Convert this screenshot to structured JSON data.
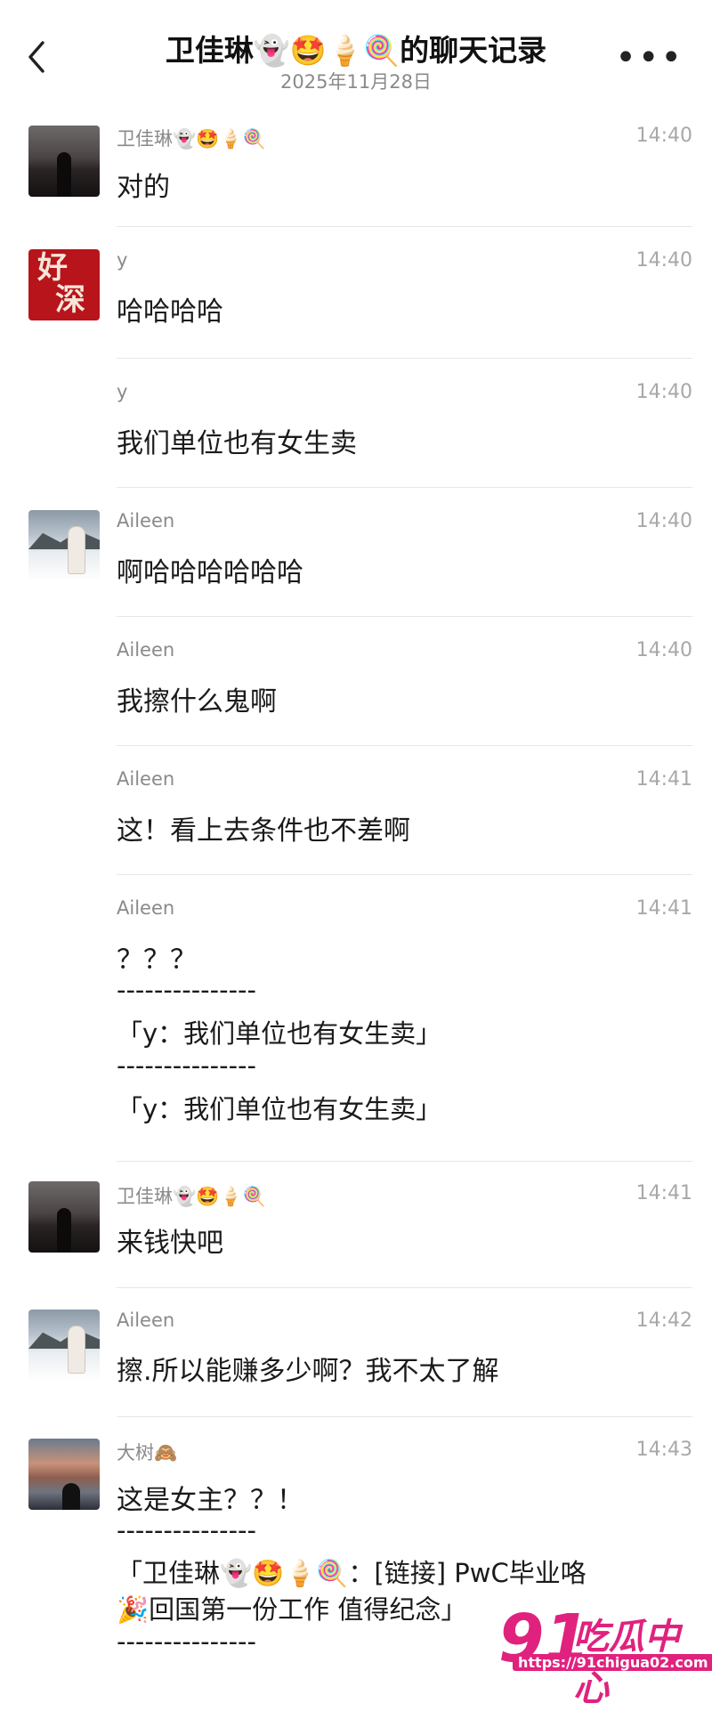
{
  "header": {
    "title": "卫佳琳👻🤩🍦🍭的聊天记录",
    "date": "2025年11月28日"
  },
  "messages": [
    {
      "sender": "卫佳琳👻🤩🍦🍭",
      "time": "14:40",
      "text": "对的",
      "avatar": "night-silhouette-avatar"
    },
    {
      "sender": "y",
      "time": "14:40",
      "text": "哈哈哈哈",
      "avatar": "red-calligraphy-avatar"
    },
    {
      "sender": "y",
      "time": "14:40",
      "text": "我们单位也有女生卖",
      "avatar": ""
    },
    {
      "sender": "Aileen",
      "time": "14:40",
      "text": "啊哈哈哈哈哈哈",
      "avatar": "snow-portrait-avatar"
    },
    {
      "sender": "Aileen",
      "time": "14:40",
      "text": "我擦什么鬼啊",
      "avatar": ""
    },
    {
      "sender": "Aileen",
      "time": "14:41",
      "text": "这！看上去条件也不差啊",
      "avatar": ""
    },
    {
      "sender": "Aileen",
      "time": "14:41",
      "text": "？？？",
      "avatar": ""
    },
    {
      "sender": "卫佳琳👻🤩🍦🍭",
      "time": "14:41",
      "text": "来钱快吧",
      "avatar": "night-silhouette-avatar"
    },
    {
      "sender": "Aileen",
      "time": "14:42",
      "text": "擦.所以能赚多少啊？我不太了解",
      "avatar": "snow-portrait-avatar"
    },
    {
      "sender": "大树🙈",
      "time": "14:43",
      "text": "这是女主？？！",
      "avatar": "sunset-silhouette-avatar"
    }
  ],
  "quotes": {
    "dashes": "---------------",
    "q1": "「y：我们单位也有女生卖」",
    "q2": "「y：我们单位也有女生卖」",
    "q3_line1": "「卫佳琳👻🤩🍦🍭：[链接] PwC毕业咯",
    "q3_line2": "🎉回国第一份工作 值得纪念」"
  },
  "avatar_chars": {
    "top": "好",
    "bottom": "深"
  },
  "watermark": {
    "number": "91",
    "text": "吃瓜中心",
    "url": "https://91chigua02.com"
  },
  "colors": {
    "watermark": "#e0227e",
    "name": "#8a8a8a",
    "time": "#a8a8a8",
    "separator": "#e6e6e6"
  }
}
